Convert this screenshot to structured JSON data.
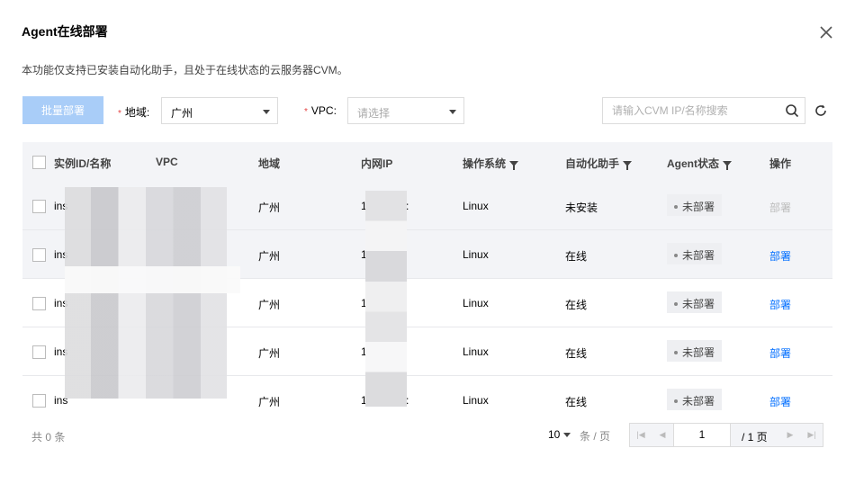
{
  "dialog": {
    "title": "Agent在线部署",
    "description": "本功能仅支持已安装自动化助手，且处于在线状态的云服务器CVM。"
  },
  "toolbar": {
    "batch_deploy_label": "批量部署",
    "region_label": "地域:",
    "region_value": "广州",
    "vpc_label": "VPC:",
    "vpc_placeholder": "请选择",
    "search_placeholder": "请输入CVM IP/名称搜索"
  },
  "table": {
    "columns": [
      "实例ID/名称",
      "VPC",
      "地域",
      "内网IP",
      "操作系统",
      "自动化助手",
      "Agent状态",
      "操作"
    ],
    "rows": [
      {
        "id": "ins",
        "region": "广州",
        "ip": "1",
        "ip_tail": ":",
        "os": "Linux",
        "assistant": "未安装",
        "agent_status": "未部署",
        "action": "部署",
        "action_enabled": false
      },
      {
        "id": "ins",
        "region": "广州",
        "ip": "1",
        "ip_tail": "",
        "os": "Linux",
        "assistant": "在线",
        "agent_status": "未部署",
        "action": "部署",
        "action_enabled": true
      },
      {
        "id": "ins",
        "region": "广州",
        "ip": "1",
        "ip_tail": "",
        "os": "Linux",
        "assistant": "在线",
        "agent_status": "未部署",
        "action": "部署",
        "action_enabled": true
      },
      {
        "id": "ins",
        "region": "广州",
        "ip": "1",
        "ip_tail": "",
        "os": "Linux",
        "assistant": "在线",
        "agent_status": "未部署",
        "action": "部署",
        "action_enabled": true
      },
      {
        "id": "ins",
        "region": "广州",
        "ip": "1",
        "ip_tail": ":",
        "os": "Linux",
        "assistant": "在线",
        "agent_status": "未部署",
        "action": "部署",
        "action_enabled": true
      }
    ]
  },
  "footer": {
    "total": "共 0 条",
    "page_size": "10",
    "page_unit": "条 / 页",
    "current_page": "1",
    "total_pages": "/ 1 页"
  },
  "colors": {
    "primary": "#006eff",
    "primary_disabled": "#a9cdf8",
    "header_bg": "#f3f4f7",
    "required": "#e54545"
  }
}
